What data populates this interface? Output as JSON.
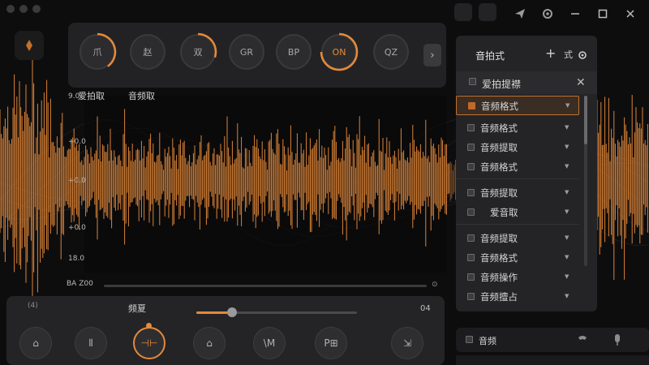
{
  "colors": {
    "accent": "#e48a3a",
    "waveform": "#e5893a",
    "background": "#0d0d0e",
    "panel": "#242426"
  },
  "window": {
    "traffic_lights": [
      "#ff5f57",
      "#febc2e",
      "#28c840"
    ],
    "controls": [
      "send-icon",
      "settings-icon",
      "minimize-icon",
      "maximize-icon",
      "close-icon"
    ]
  },
  "effects": {
    "items": [
      {
        "name": "爱拍取",
        "icon_text": "爪",
        "label": "爱拍取",
        "arc": 0.4
      },
      {
        "name": "音频取",
        "icon_text": "赵",
        "label": "音频取",
        "arc": 0
      },
      {
        "name": "双",
        "icon_text": "双",
        "label": "",
        "arc": 0.3
      },
      {
        "name": "GR",
        "icon_text": "GR",
        "label": "",
        "arc": 0
      },
      {
        "name": "BP",
        "icon_text": "BP",
        "label": "",
        "arc": 0
      },
      {
        "name": "ON",
        "icon_text": "ON",
        "label": "",
        "arc": 0.75
      },
      {
        "name": "QZ",
        "icon_text": "QZ",
        "label": "",
        "arc": 0
      }
    ],
    "next_icon": "chevron-right-icon"
  },
  "waveform": {
    "axis_labels": [
      "9.0",
      "+0.0",
      "+0.0",
      "+0.0",
      "18.0"
    ]
  },
  "timeline": {
    "label": "BA Z00",
    "end_icon": "marker-icon"
  },
  "transport": {
    "time": "(4)",
    "title": "频夏",
    "count": "04",
    "progress": 0.22,
    "buttons": [
      {
        "name": "home-icon",
        "text": "⌂"
      },
      {
        "name": "equalizer-icon",
        "text": "⫴"
      },
      {
        "name": "split-icon",
        "text": "⊣⊢"
      },
      {
        "name": "house-icon",
        "text": "⌂"
      },
      {
        "name": "wm-icon",
        "text": "\\M"
      },
      {
        "name": "pb-icon",
        "text": "P⊞"
      },
      {
        "name": "export-icon",
        "text": "⇲"
      }
    ]
  },
  "right_panel": {
    "title": "音拍式",
    "add_label": "+",
    "format_label": "式",
    "sub_header": "爱拍提襟",
    "items": [
      {
        "label": "音频格式",
        "selected": true,
        "indent": false,
        "caret": true
      },
      {
        "label": "音频格式",
        "selected": false,
        "indent": false,
        "caret": true
      },
      {
        "label": "音频提取",
        "selected": false,
        "indent": false,
        "caret": true
      },
      {
        "label": "音频格式",
        "selected": false,
        "indent": false,
        "caret": true
      },
      {
        "label": "音频提取",
        "selected": false,
        "indent": false,
        "caret": true
      },
      {
        "label": "爱音取",
        "selected": false,
        "indent": true,
        "caret": true
      },
      {
        "label": "音频提取",
        "selected": false,
        "indent": false,
        "caret": true
      },
      {
        "label": "音频格式",
        "selected": false,
        "indent": false,
        "caret": true
      },
      {
        "label": "音频操作",
        "selected": false,
        "indent": false,
        "caret": true
      },
      {
        "label": "音频擅占",
        "selected": false,
        "indent": false,
        "caret": true
      }
    ]
  },
  "bottom_right": {
    "label": "音频"
  }
}
